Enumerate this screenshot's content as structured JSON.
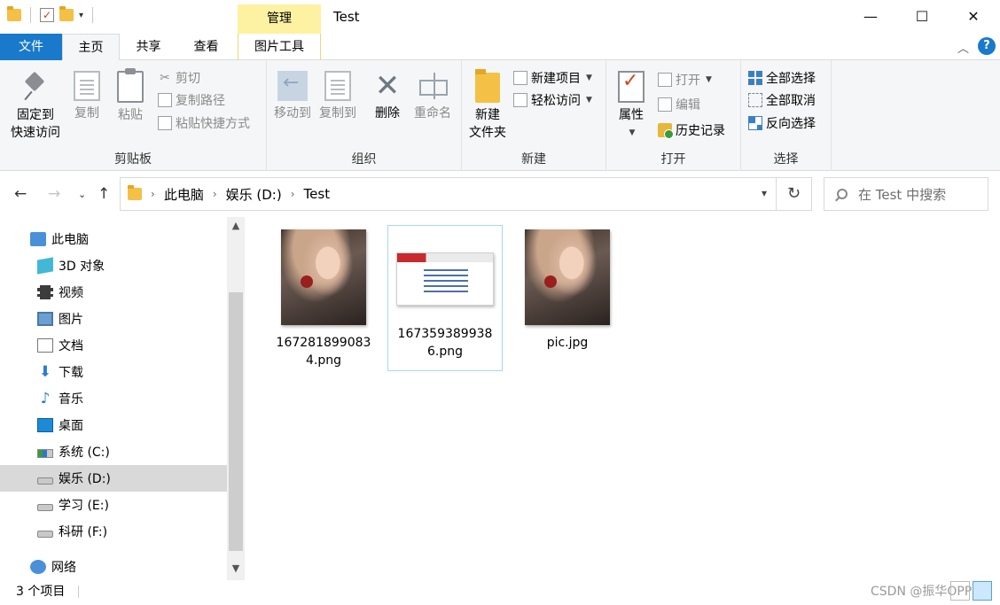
{
  "window": {
    "title": "Test",
    "context_tab": "管理",
    "controls": {
      "minimize": "—",
      "maximize": "☐",
      "close": "✕"
    }
  },
  "tabs": {
    "file": "文件",
    "home": "主页",
    "share": "共享",
    "view": "查看",
    "picture_tools": "图片工具",
    "help": "?"
  },
  "ribbon": {
    "clipboard": {
      "title": "剪贴板",
      "pin_line1": "固定到",
      "pin_line2": "快速访问",
      "copy": "复制",
      "paste": "粘贴",
      "cut": "剪切",
      "copy_path": "复制路径",
      "paste_shortcut": "粘贴快捷方式"
    },
    "organize": {
      "title": "组织",
      "move_to": "移动到",
      "copy_to": "复制到",
      "delete": "删除",
      "rename": "重命名"
    },
    "new": {
      "title": "新建",
      "new_folder_line1": "新建",
      "new_folder_line2": "文件夹",
      "new_item": "新建项目",
      "easy_access": "轻松访问"
    },
    "open": {
      "title": "打开",
      "properties": "属性",
      "open": "打开",
      "edit": "编辑",
      "history": "历史记录"
    },
    "select": {
      "title": "选择",
      "select_all": "全部选择",
      "select_none": "全部取消",
      "invert": "反向选择"
    }
  },
  "address": {
    "crumbs": [
      "此电脑",
      "娱乐 (D:)",
      "Test"
    ],
    "search_placeholder": "在 Test 中搜索"
  },
  "nav": {
    "items": [
      {
        "label": "此电脑",
        "icon": "computer-icon"
      },
      {
        "label": "3D 对象",
        "icon": "3d-objects-icon"
      },
      {
        "label": "视频",
        "icon": "video-icon"
      },
      {
        "label": "图片",
        "icon": "pictures-icon"
      },
      {
        "label": "文档",
        "icon": "documents-icon"
      },
      {
        "label": "下载",
        "icon": "downloads-icon"
      },
      {
        "label": "音乐",
        "icon": "music-icon"
      },
      {
        "label": "桌面",
        "icon": "desktop-icon"
      },
      {
        "label": "系统 (C:)",
        "icon": "drive-c-icon"
      },
      {
        "label": "娱乐 (D:)",
        "icon": "drive-icon",
        "selected": true
      },
      {
        "label": "学习 (E:)",
        "icon": "drive-icon"
      },
      {
        "label": "科研 (F:)",
        "icon": "drive-icon"
      },
      {
        "label": "网络",
        "icon": "network-icon"
      }
    ]
  },
  "files": [
    {
      "name": "1672818990834.png",
      "name_line1": "167281899083",
      "name_line2": "4.png",
      "kind": "photo"
    },
    {
      "name": "1673593899386.png",
      "name_line1": "167359389938",
      "name_line2": "6.png",
      "kind": "screenshot",
      "selected": true
    },
    {
      "name": "pic.jpg",
      "name_line1": "pic.jpg",
      "name_line2": "",
      "kind": "photo"
    }
  ],
  "status": {
    "count": "3 个项目",
    "watermark": "CSDN @振华OPPO"
  },
  "colors": {
    "file_tab": "#1979ca",
    "context_tab": "#fdf2a2",
    "selection": "#d9d9d9",
    "item_border": "#a8d8ea"
  }
}
